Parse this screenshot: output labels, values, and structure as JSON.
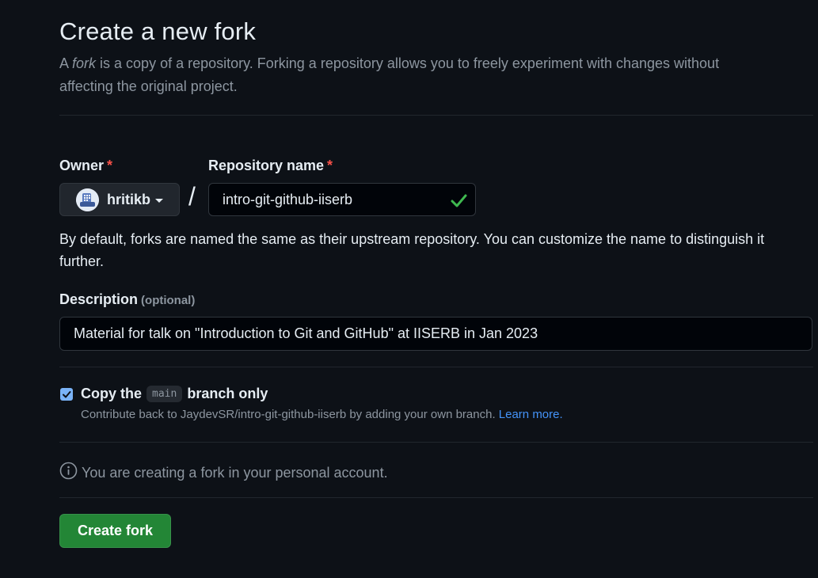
{
  "header": {
    "title": "Create a new fork",
    "subtitle_prefix": "A ",
    "subtitle_em": "fork",
    "subtitle_rest": " is a copy of a repository. Forking a repository allows you to freely experiment with changes without affecting the original project."
  },
  "owner": {
    "label": "Owner",
    "required_mark": "*",
    "value": "hritikb",
    "icon": "avatar"
  },
  "separator": "/",
  "repository": {
    "label": "Repository name",
    "required_mark": "*",
    "value": "intro-git-github-iiserb",
    "valid_icon": "check-icon"
  },
  "naming_note": "By default, forks are named the same as their upstream repository. You can customize the name to distinguish it further.",
  "description": {
    "label": "Description",
    "optional_label": "(optional)",
    "value": "Material for talk on \"Introduction to Git and GitHub\" at IISERB in Jan 2023"
  },
  "copy_branch": {
    "checked": true,
    "label_prefix": "Copy the",
    "branch": "main",
    "label_suffix": "branch only",
    "help_text": "Contribute back to JaydevSR/intro-git-github-iiserb by adding your own branch.",
    "help_link": "Learn more."
  },
  "info": {
    "icon": "info-icon",
    "text": "You are creating a fork in your personal account."
  },
  "submit": {
    "label": "Create fork"
  },
  "colors": {
    "background": "#0d1117",
    "primary_button": "#238636",
    "link": "#4493f8",
    "success": "#3fb950",
    "required": "#f85149"
  }
}
